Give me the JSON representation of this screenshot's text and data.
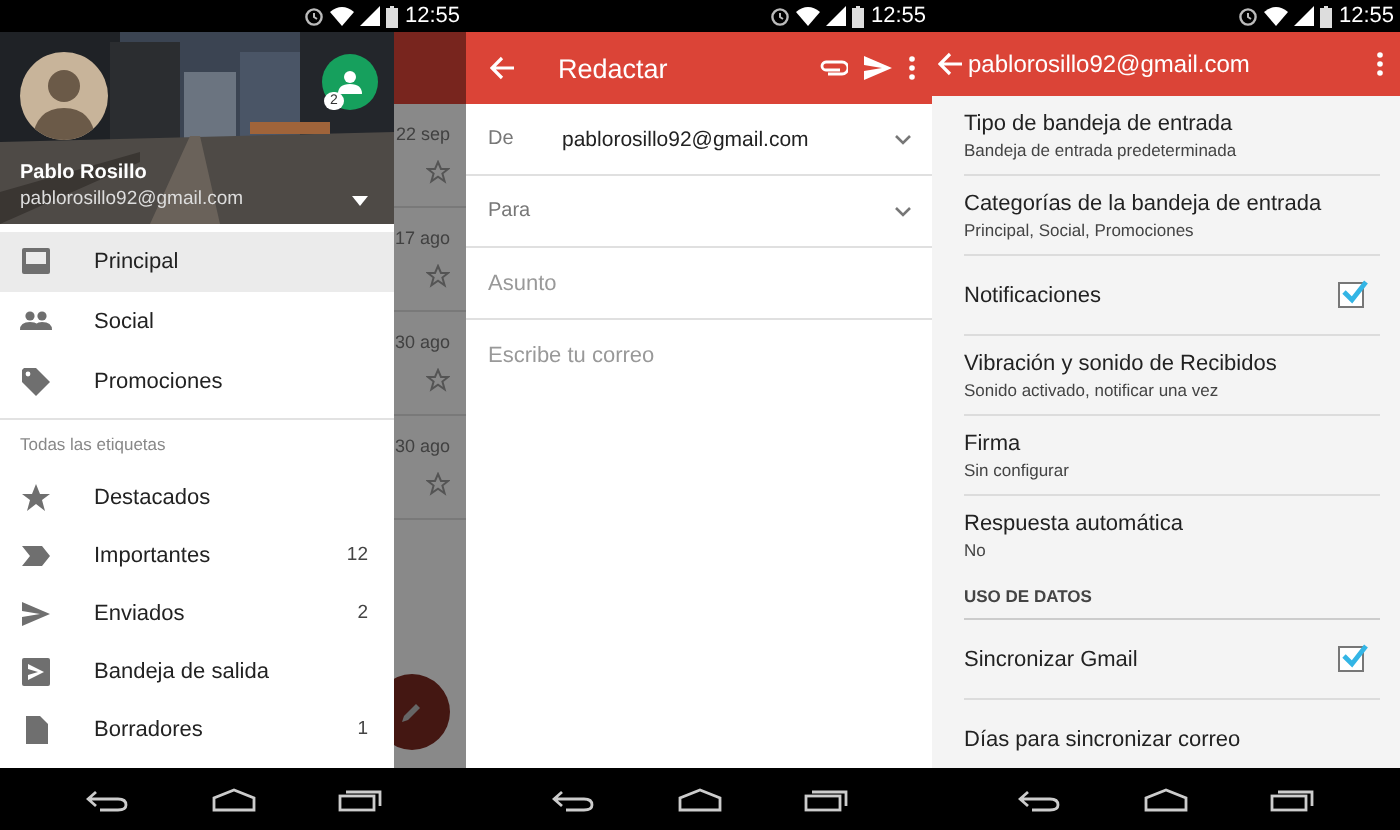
{
  "screens": [
    {
      "kind": "drawer",
      "time": "12:55",
      "account": {
        "name": "Pablo Rosillo",
        "email": "pablorosillo92@gmail.com",
        "badge": "2"
      },
      "primary_items": [
        {
          "label": "Principal",
          "selected": true
        },
        {
          "label": "Social",
          "selected": false
        },
        {
          "label": "Promociones",
          "selected": false
        }
      ],
      "section_title": "Todas las etiquetas",
      "label_items": [
        {
          "label": "Destacados",
          "selected": false
        },
        {
          "label": "Importantes",
          "count": "12",
          "selected": false
        },
        {
          "label": "Enviados",
          "count": "2",
          "selected": false
        },
        {
          "label": "Bandeja de salida",
          "selected": false
        },
        {
          "label": "Borradores",
          "count": "1",
          "selected": false
        }
      ],
      "background_messages": [
        {
          "date": "22 sep"
        },
        {
          "date": "17 ago"
        },
        {
          "date": "30 ago"
        },
        {
          "date": "30 ago"
        }
      ]
    },
    {
      "kind": "compose",
      "time": "12:55",
      "title": "Redactar",
      "fields": [
        {
          "kind": "select",
          "label": "De",
          "value": "pablorosillo92@gmail.com"
        },
        {
          "kind": "select",
          "label": "Para"
        },
        {
          "kind": "input",
          "placeholder": "Asunto"
        }
      ],
      "body_placeholder": "Escribe tu correo"
    },
    {
      "kind": "settings",
      "time": "12:55",
      "title": "pablorosillo92@gmail.com",
      "items": [
        {
          "kind": "item",
          "title": "Tipo de bandeja de entrada",
          "subtitle": "Bandeja de entrada predeterminada"
        },
        {
          "kind": "item",
          "title": "Categorías de la bandeja de entrada",
          "subtitle": "Principal, Social, Promociones"
        },
        {
          "kind": "checkbox",
          "title": "Notificaciones",
          "checked": true
        },
        {
          "kind": "item",
          "title": "Vibración y sonido de Recibidos",
          "subtitle": "Sonido activado, notificar una vez"
        },
        {
          "kind": "item",
          "title": "Firma",
          "subtitle": "Sin configurar"
        },
        {
          "kind": "item",
          "title": "Respuesta automática",
          "subtitle": "No"
        },
        {
          "kind": "header",
          "title": "USO DE DATOS"
        },
        {
          "kind": "checkbox",
          "title": "Sincronizar Gmail",
          "checked": true
        },
        {
          "kind": "item",
          "title": "Días para sincronizar correo"
        }
      ]
    }
  ]
}
